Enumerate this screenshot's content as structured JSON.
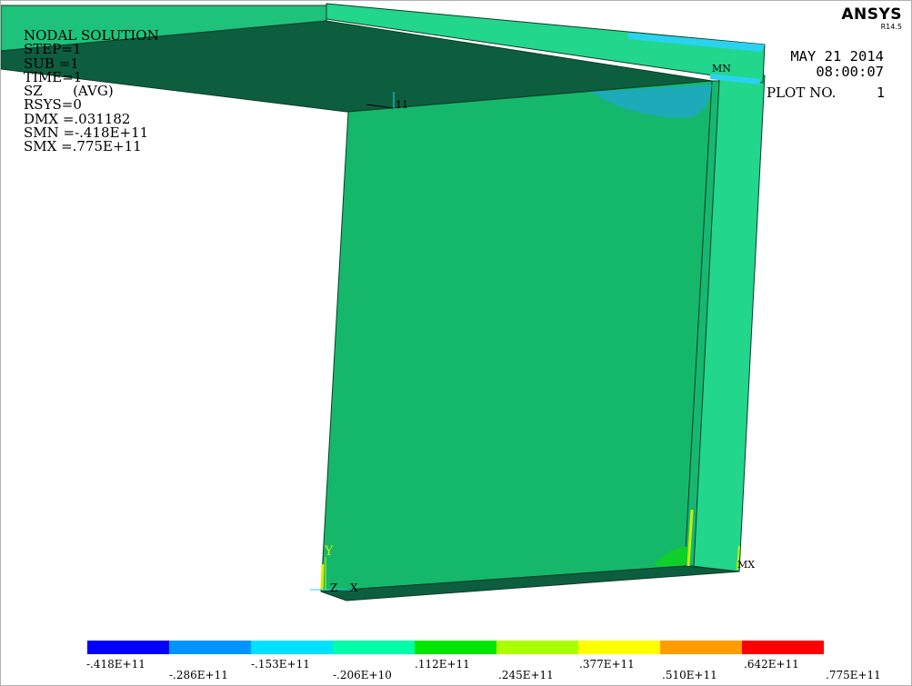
{
  "brand": {
    "name": "ANSYS",
    "version": "R14.5"
  },
  "info": {
    "title": "NODAL SOLUTION",
    "lines": [
      "STEP=1",
      "SUB =1",
      "TIME=1",
      "SZ       (AVG)",
      "RSYS=0",
      "DMX =.031182",
      "SMN =-.418E+11",
      "SMX =.775E+11"
    ]
  },
  "date": {
    "date": "MAY 21 2014",
    "time": "08:00:07",
    "plot_label": "PLOT NO.",
    "plot_no": "1"
  },
  "markers": {
    "mn": "MN",
    "mx": "MX",
    "node": "11",
    "axis_y": "Y",
    "axis_z": "Z",
    "axis_x": "X"
  },
  "legend": {
    "colors": [
      "#0000ff",
      "#0094ff",
      "#00e1ff",
      "#00ffa8",
      "#00e600",
      "#aaff00",
      "#ffff00",
      "#ff9c00",
      "#ff0000"
    ],
    "top_labels": [
      "-.418E+11",
      "-.153E+11",
      ".112E+11",
      ".377E+11",
      ".642E+11"
    ],
    "bottom_labels": [
      "-.286E+11",
      "-.206E+10",
      ".245E+11",
      ".510E+11",
      ".775E+11"
    ]
  },
  "palette": {
    "panel_main": "#15b86b",
    "panel_light": "#26c97b",
    "top_dark": "#0d5e3f",
    "flange_light": "#22d68c",
    "cyan_edge": "#2ad2f0",
    "blue_zone": "#1ea8c2"
  }
}
